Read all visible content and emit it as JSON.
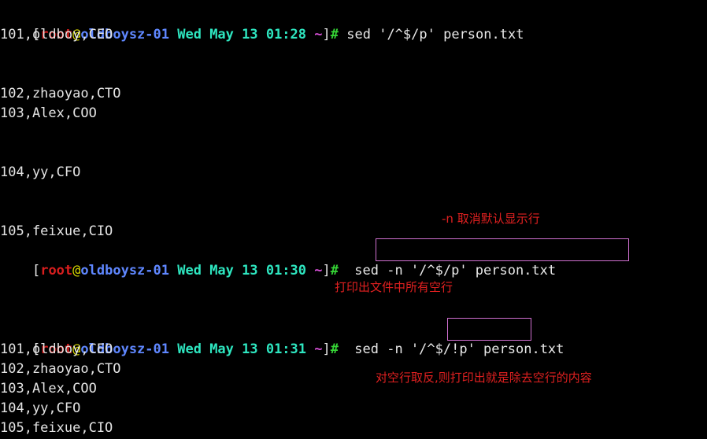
{
  "terminal": {
    "title": "terminal",
    "prompt": {
      "open_bracket": "[",
      "user": "root",
      "at": "@",
      "host": "oldboysz-01",
      "close": "]",
      "hash": "#",
      "tilde": "~",
      "separator": " "
    },
    "blocks": [
      {
        "id": "block-1",
        "prompt_date": "Wed May 13 01:28",
        "command": "sed '/^$/p' person.txt",
        "output": [
          "101,oldboy,CEO",
          "",
          "",
          "102,zhaoyao,CTO",
          "103,Alex,COO",
          "",
          "",
          "104,yy,CFO",
          "",
          "",
          "105,feixue,CIO"
        ]
      },
      {
        "id": "block-2",
        "prompt_date": "Wed May 13 01:30",
        "command": "sed -n '/^$/p' person.txt",
        "output": []
      },
      {
        "id": "block-3",
        "prompt_date": "Wed May 13 01:31",
        "command_prefix": "sed -n ",
        "command_highlight": "'/^$/!p'",
        "command_suffix": " person.txt",
        "output": [
          "101,oldboy,CEO",
          "102,zhaoyao,CTO",
          "103,Alex,COO",
          "104,yy,CFO",
          "105,feixue,CIO"
        ]
      }
    ],
    "annotations": [
      {
        "id": "annotation-n-option",
        "text": "-n 取消默认显示行",
        "color": "#e02020"
      },
      {
        "id": "annotation-print-blank-lines",
        "text": "打印出文件中所有空行",
        "color": "#e02020"
      },
      {
        "id": "annotation-negate-blank-lines",
        "text": "对空行取反,则打印出就是除去空行的内容",
        "color": "#e02020"
      }
    ],
    "colors": {
      "background": "#000000",
      "foreground": "#d8d8d8",
      "user": "#d81e1e",
      "at": "#d7d700",
      "host": "#5f87ff",
      "date": "#2ee6c0",
      "tilde": "#d750d7",
      "hash": "#35d435",
      "highlight_box": "#d070d0",
      "annotation": "#e02020"
    }
  }
}
